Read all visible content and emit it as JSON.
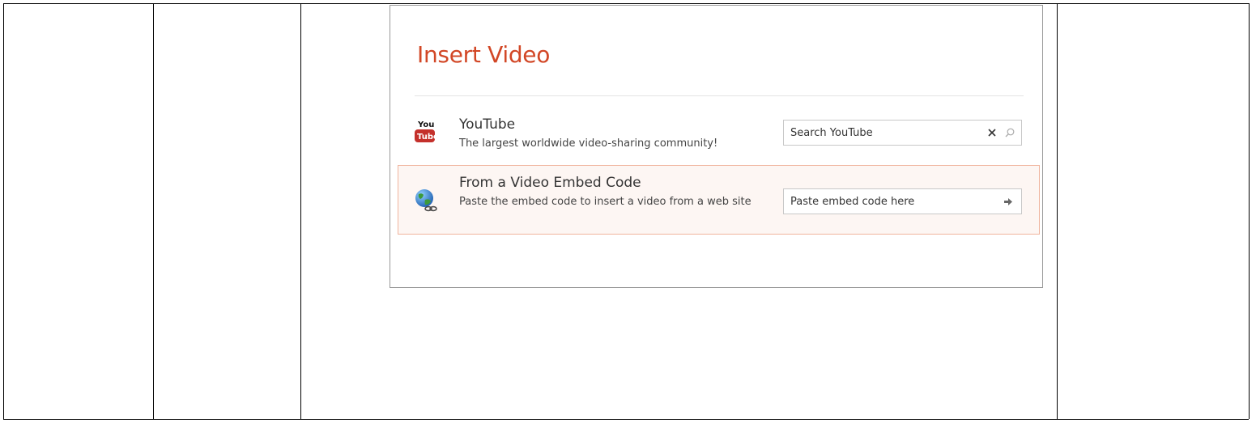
{
  "dialog": {
    "title": "Insert Video",
    "accent_color": "#d24726",
    "sources": [
      {
        "icon": "youtube-icon",
        "title": "YouTube",
        "description": "The largest worldwide video-sharing community!",
        "field_placeholder": "Search YouTube",
        "actions": [
          "clear-icon",
          "search-icon"
        ]
      },
      {
        "icon": "globe-link-icon",
        "title": "From a Video Embed Code",
        "description": "Paste the embed code to insert a video from a web site",
        "field_placeholder": "Paste embed code here",
        "actions": [
          "arrow-right-icon"
        ],
        "selected": true
      }
    ]
  }
}
